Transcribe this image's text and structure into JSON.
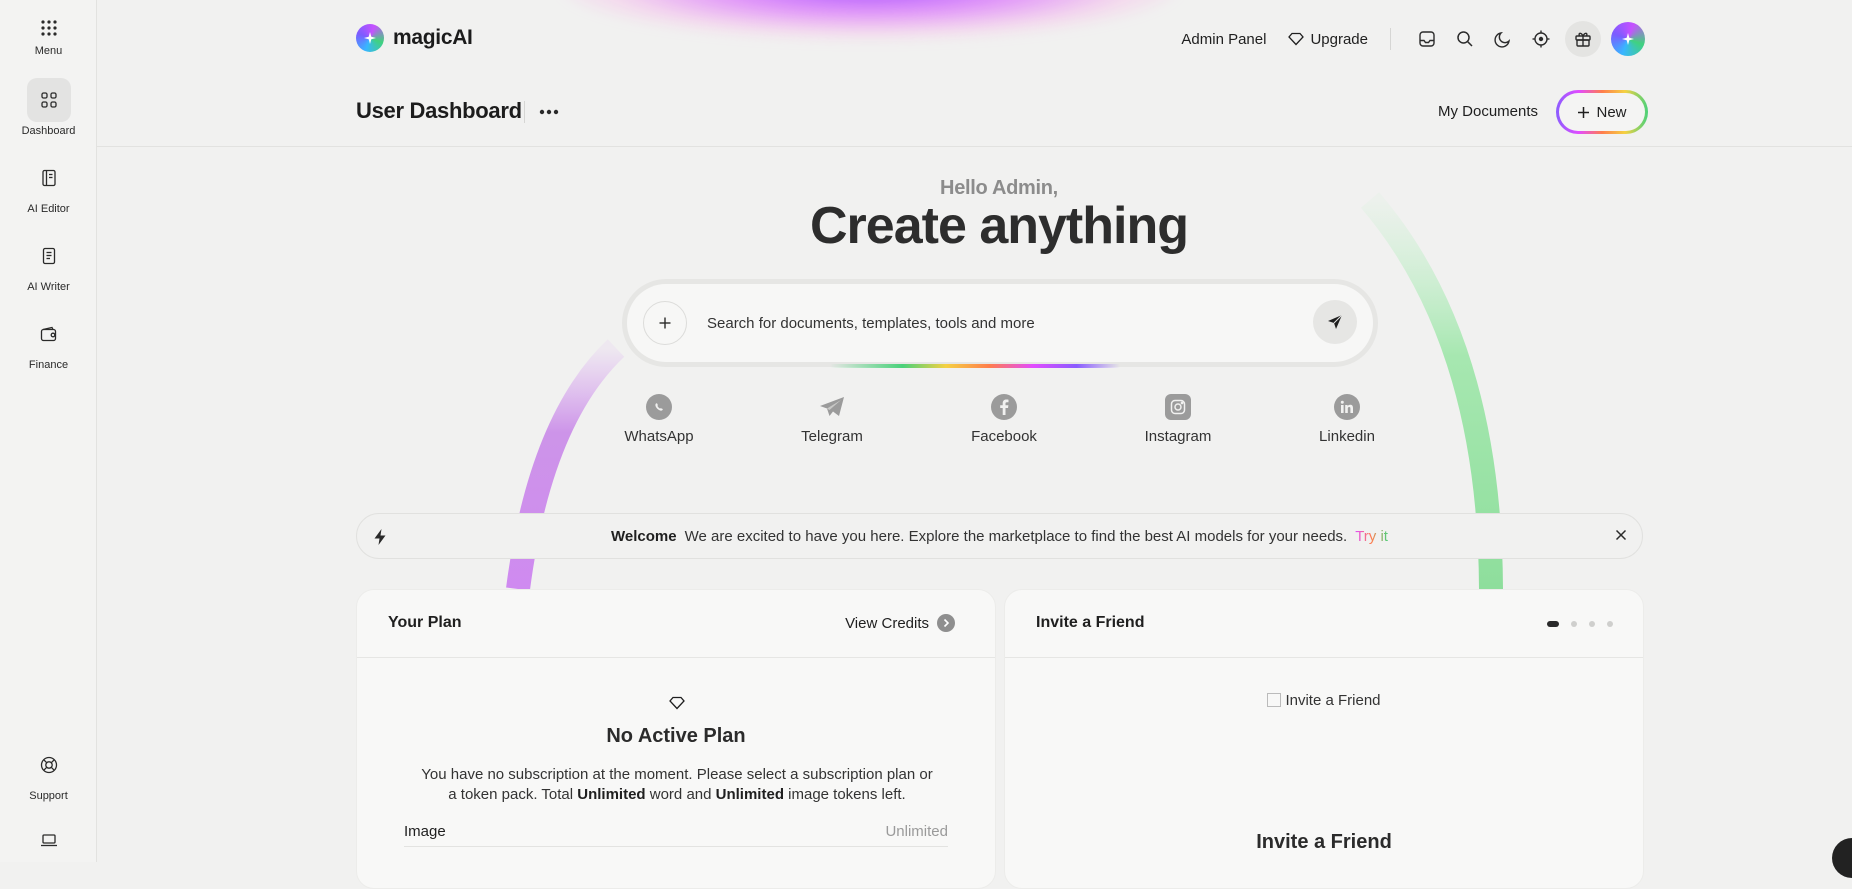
{
  "sidebar": {
    "menu_label": "Menu",
    "items": [
      {
        "label": "Dashboard",
        "icon": "dashboard-grid-icon"
      },
      {
        "label": "AI Editor",
        "icon": "book-icon"
      },
      {
        "label": "AI Writer",
        "icon": "document-icon"
      },
      {
        "label": "Finance",
        "icon": "wallet-icon"
      }
    ],
    "support_label": "Support"
  },
  "header": {
    "logo_text": "magicAI",
    "admin_panel": "Admin Panel",
    "upgrade": "Upgrade",
    "page_title": "User Dashboard",
    "my_documents": "My Documents",
    "new_button": "New"
  },
  "hero": {
    "greeting": "Hello Admin,",
    "headline": "Create anything",
    "search_placeholder": "Search for documents, templates, tools and more"
  },
  "socials": [
    {
      "label": "WhatsApp",
      "icon": "whatsapp-icon"
    },
    {
      "label": "Telegram",
      "icon": "telegram-icon"
    },
    {
      "label": "Facebook",
      "icon": "facebook-icon"
    },
    {
      "label": "Instagram",
      "icon": "instagram-icon"
    },
    {
      "label": "Linkedin",
      "icon": "linkedin-icon"
    }
  ],
  "banner": {
    "title": "Welcome",
    "message": "We are excited to have you here. Explore the marketplace to find the best AI models for your needs.",
    "link": "Try it"
  },
  "plan_card": {
    "title": "Your Plan",
    "view_credits": "View Credits",
    "status_title": "No Active Plan",
    "desc_part1": "You have no subscription at the moment. Please select a subscription plan or a token pack. Total ",
    "word_tokens": "Unlimited",
    "desc_part2": " word and ",
    "image_tokens": "Unlimited",
    "desc_part3": " image tokens left.",
    "row_label": "Image",
    "row_value": "Unlimited"
  },
  "invite_card": {
    "title": "Invite a Friend",
    "image_alt": "Invite a Friend",
    "heading": "Invite a Friend"
  },
  "colors": {
    "background": "#f1f1f0",
    "accent_purple": "#8a5cff",
    "accent_green": "#49d17a",
    "accent_pink": "#e24cff"
  }
}
